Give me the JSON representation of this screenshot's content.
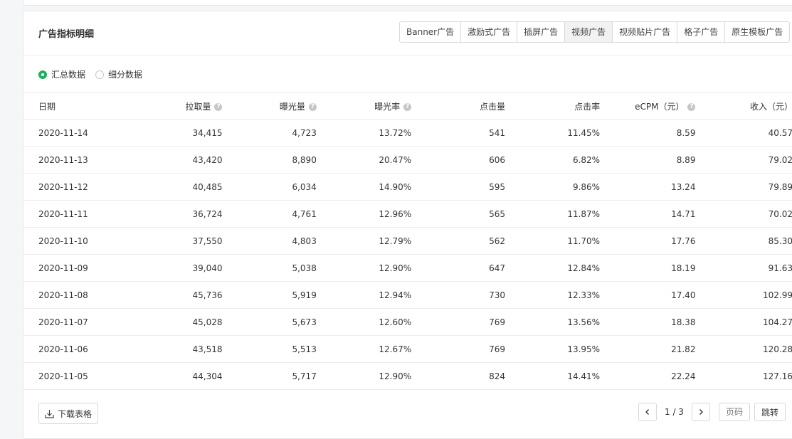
{
  "card": {
    "title": "广告指标明细",
    "tabs": [
      {
        "label": "Banner广告",
        "active": false
      },
      {
        "label": "激励式广告",
        "active": false
      },
      {
        "label": "插屏广告",
        "active": false
      },
      {
        "label": "视频广告",
        "active": true
      },
      {
        "label": "视频贴片广告",
        "active": false
      },
      {
        "label": "格子广告",
        "active": false
      },
      {
        "label": "原生模板广告",
        "active": false
      }
    ]
  },
  "radios": [
    {
      "label": "汇总数据",
      "checked": true
    },
    {
      "label": "细分数据",
      "checked": false
    }
  ],
  "table": {
    "columns": [
      {
        "label": "日期",
        "help": false
      },
      {
        "label": "拉取量",
        "help": true
      },
      {
        "label": "曝光量",
        "help": true
      },
      {
        "label": "曝光率",
        "help": true
      },
      {
        "label": "点击量",
        "help": false
      },
      {
        "label": "点击率",
        "help": false
      },
      {
        "label": "eCPM（元）",
        "help": true
      },
      {
        "label": "收入（元）",
        "help": false
      }
    ],
    "rows": [
      [
        "2020-11-14",
        "34,415",
        "4,723",
        "13.72%",
        "541",
        "11.45%",
        "8.59",
        "40.57"
      ],
      [
        "2020-11-13",
        "43,420",
        "8,890",
        "20.47%",
        "606",
        "6.82%",
        "8.89",
        "79.02"
      ],
      [
        "2020-11-12",
        "40,485",
        "6,034",
        "14.90%",
        "595",
        "9.86%",
        "13.24",
        "79.89"
      ],
      [
        "2020-11-11",
        "36,724",
        "4,761",
        "12.96%",
        "565",
        "11.87%",
        "14.71",
        "70.02"
      ],
      [
        "2020-11-10",
        "37,550",
        "4,803",
        "12.79%",
        "562",
        "11.70%",
        "17.76",
        "85.30"
      ],
      [
        "2020-11-09",
        "39,040",
        "5,038",
        "12.90%",
        "647",
        "12.84%",
        "18.19",
        "91.63"
      ],
      [
        "2020-11-08",
        "45,736",
        "5,919",
        "12.94%",
        "730",
        "12.33%",
        "17.40",
        "102.99"
      ],
      [
        "2020-11-07",
        "45,028",
        "5,673",
        "12.60%",
        "769",
        "13.56%",
        "18.38",
        "104.27"
      ],
      [
        "2020-11-06",
        "43,518",
        "5,513",
        "12.67%",
        "769",
        "13.95%",
        "21.82",
        "120.28"
      ],
      [
        "2020-11-05",
        "44,304",
        "5,717",
        "12.90%",
        "824",
        "14.41%",
        "22.24",
        "127.16"
      ]
    ]
  },
  "footer": {
    "download_label": "下载表格",
    "page_indicator": "1 / 3",
    "page_input_placeholder": "页码",
    "jump_label": "跳转"
  },
  "colors": {
    "accent_green": "#1fb05a",
    "border": "#d9d9d9",
    "active_tab_bg": "#f2f2f2"
  },
  "icons": {
    "help": "question-circle-icon",
    "download": "download-icon",
    "prev": "chevron-left-icon",
    "next": "chevron-right-icon"
  }
}
